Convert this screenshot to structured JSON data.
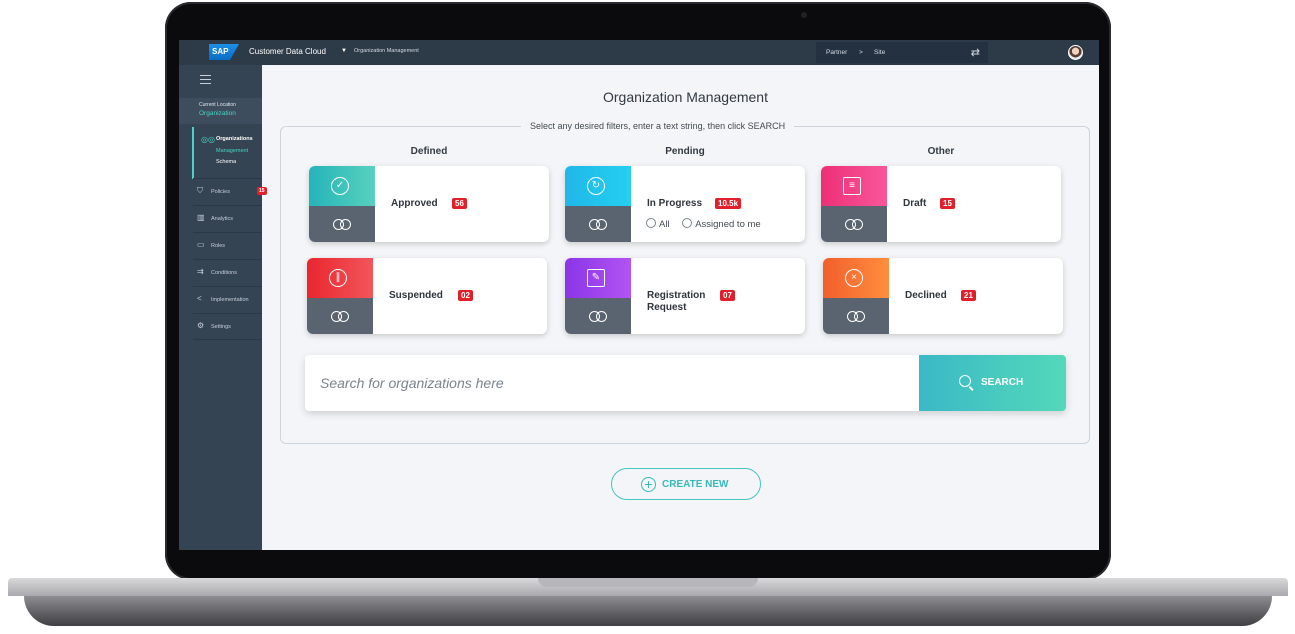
{
  "topbar": {
    "logo_text": "SAP",
    "app_name": "Customer Data Cloud",
    "crumb": "Organization Management",
    "context_partner": "Partner",
    "context_sep": ">",
    "context_site": "Site"
  },
  "sidebar": {
    "current_location_label": "Current Location",
    "current_location_value": "Organization",
    "organizations": {
      "title": "Organizations",
      "sub": [
        "Management",
        "Schema"
      ]
    },
    "items": [
      {
        "label": "Policies",
        "badge": "15",
        "icon": "shield-icon"
      },
      {
        "label": "Analytics",
        "icon": "bar-chart-icon"
      },
      {
        "label": "Roles",
        "icon": "laptop-icon"
      },
      {
        "label": "Conditions",
        "icon": "split-arrows-icon"
      },
      {
        "label": "Implementation",
        "icon": "share-icon"
      },
      {
        "label": "Settings",
        "icon": "gear-icon"
      }
    ]
  },
  "main": {
    "title": "Organization Management",
    "filter_hint": "Select any desired filters, enter a text string, then click SEARCH",
    "columns": [
      "Defined",
      "Pending",
      "Other"
    ],
    "cards": [
      {
        "label": "Approved",
        "badge": "56",
        "icon": "check-circle-icon",
        "color_from": "#25b4b9",
        "color_to": "#58d1be"
      },
      {
        "label": "In Progress",
        "badge": "10.5k",
        "icon": "progress-circle-icon",
        "color_from": "#1fb7e8",
        "color_to": "#25d0f0",
        "radio_all": "All",
        "radio_assigned": "Assigned to me"
      },
      {
        "label": "Draft",
        "badge": "15",
        "icon": "document-icon",
        "color_from": "#ee2f76",
        "color_to": "#f8579a"
      },
      {
        "label": "Suspended",
        "badge": "02",
        "icon": "pause-circle-icon",
        "color_from": "#e9262e",
        "color_to": "#f3555c"
      },
      {
        "label_line1": "Registration",
        "label_line2": "Request",
        "badge": "07",
        "icon": "edit-document-icon",
        "color_from": "#8a35e8",
        "color_to": "#b254f2"
      },
      {
        "label": "Declined",
        "badge": "21",
        "icon": "x-circle-icon",
        "color_from": "#f25f2c",
        "color_to": "#ff8e3e"
      }
    ],
    "search": {
      "placeholder": "Search for organizations here",
      "button_label": "SEARCH"
    },
    "create_label": "CREATE NEW"
  },
  "colors": {
    "accent": "#46c4bf",
    "badge": "#e0202a",
    "topbar": "#2d3a48",
    "sidebar": "#354453"
  }
}
